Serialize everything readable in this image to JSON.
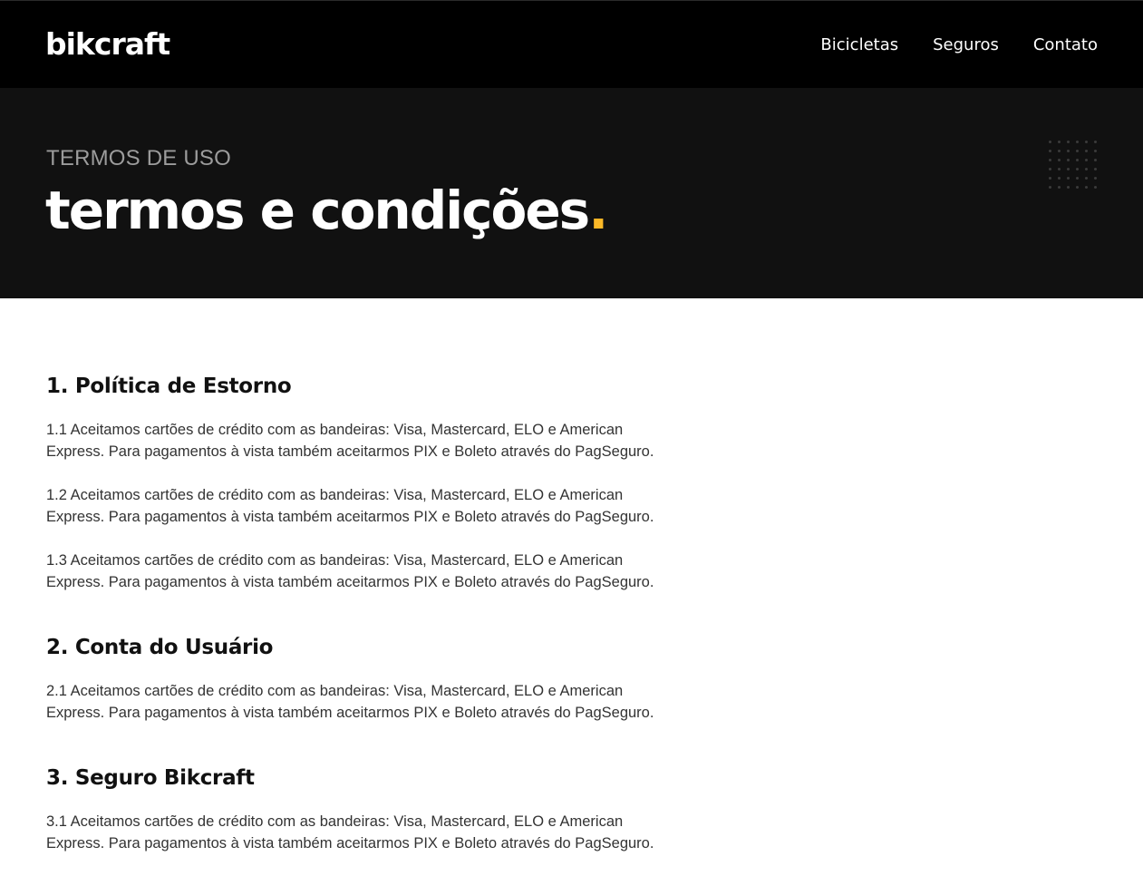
{
  "header": {
    "logo": "bikcraft",
    "nav": [
      "Bicicletas",
      "Seguros",
      "Contato"
    ]
  },
  "hero": {
    "subtitle": "TERMOS DE USO",
    "title": "termos e condições",
    "title_dot": "."
  },
  "sections": [
    {
      "heading": "1. Política de Estorno",
      "paragraphs": [
        "1.1 Aceitamos cartões de crédito com as bandeiras: Visa, Mastercard, ELO e American Express. Para pagamentos à vista também aceitarmos PIX e Boleto através do PagSeguro.",
        "1.2 Aceitamos cartões de crédito com as bandeiras: Visa, Mastercard, ELO e American Express. Para pagamentos à vista também aceitarmos PIX e Boleto através do PagSeguro.",
        "1.3 Aceitamos cartões de crédito com as bandeiras: Visa, Mastercard, ELO e American Express. Para pagamentos à vista também aceitarmos PIX e Boleto através do PagSeguro."
      ]
    },
    {
      "heading": "2. Conta do Usuário",
      "paragraphs": [
        "2.1 Aceitamos cartões de crédito com as bandeiras: Visa, Mastercard, ELO e American Express. Para pagamentos à vista também aceitarmos PIX e Boleto através do PagSeguro."
      ]
    },
    {
      "heading": "3. Seguro Bikcraft",
      "paragraphs": [
        "3.1 Aceitamos cartões de crédito com as bandeiras: Visa, Mastercard, ELO e American Express. Para pagamentos à vista também aceitarmos PIX e Boleto através do PagSeguro."
      ]
    }
  ],
  "colors": {
    "header_bg": "#000000",
    "hero_bg": "#111111",
    "accent": "#fbb827",
    "subtitle": "#9c9c9c",
    "body_text": "#333333"
  }
}
